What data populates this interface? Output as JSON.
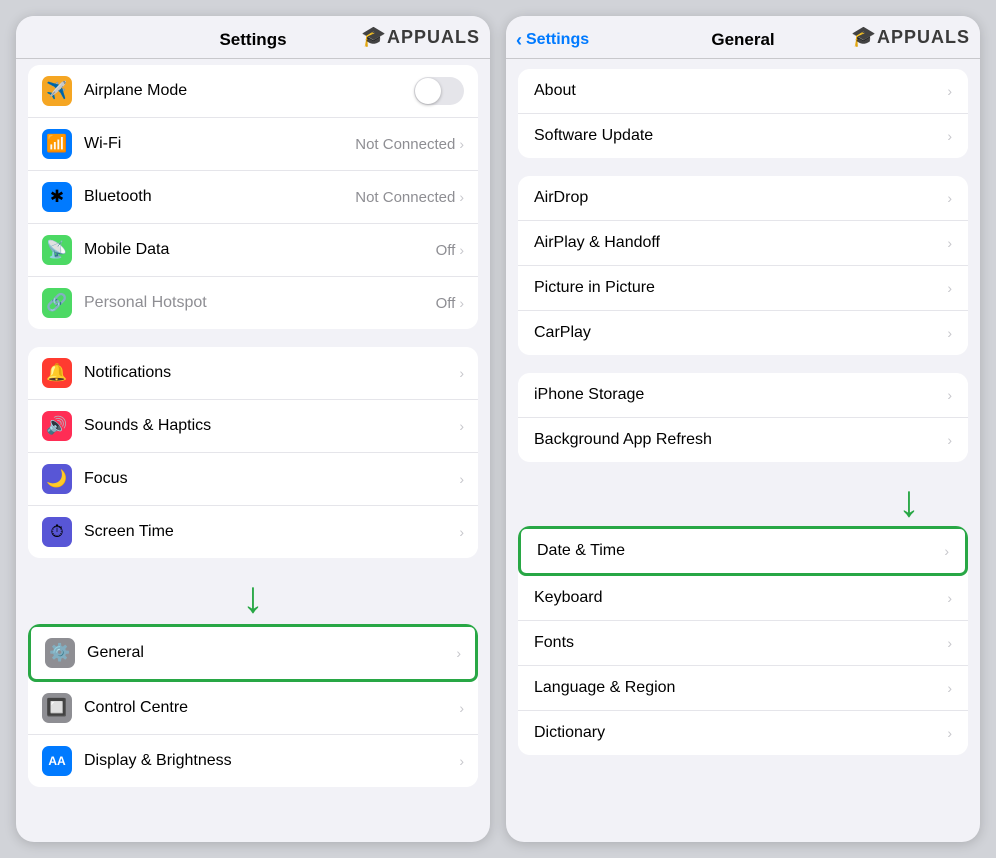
{
  "left_panel": {
    "header": "Settings",
    "appuals": "APPUALS",
    "groups": [
      {
        "id": "connectivity",
        "rows": [
          {
            "icon": "✈",
            "icon_bg": "#f5a623",
            "label": "Airplane Mode",
            "value": "",
            "type": "toggle"
          },
          {
            "icon": "📶",
            "icon_bg": "#007aff",
            "label": "Wi-Fi",
            "value": "Not Connected",
            "type": "chevron"
          },
          {
            "icon": "✱",
            "icon_bg": "#007aff",
            "label": "Bluetooth",
            "value": "Not Connected",
            "type": "chevron"
          },
          {
            "icon": "📡",
            "icon_bg": "#4cd964",
            "label": "Mobile Data",
            "value": "Off",
            "type": "chevron"
          },
          {
            "icon": "🔗",
            "icon_bg": "#4cd964",
            "label": "Personal Hotspot",
            "value": "Off",
            "type": "chevron"
          }
        ]
      },
      {
        "id": "notifications",
        "rows": [
          {
            "icon": "🔔",
            "icon_bg": "#ff3b30",
            "label": "Notifications",
            "value": "",
            "type": "chevron"
          },
          {
            "icon": "🔊",
            "icon_bg": "#ff2d55",
            "label": "Sounds & Haptics",
            "value": "",
            "type": "chevron"
          },
          {
            "icon": "🌙",
            "icon_bg": "#5856d6",
            "label": "Focus",
            "value": "",
            "type": "chevron"
          },
          {
            "icon": "⏱",
            "icon_bg": "#5856d6",
            "label": "Screen Time",
            "value": "",
            "type": "chevron"
          }
        ]
      },
      {
        "id": "system",
        "rows": [
          {
            "icon": "⚙",
            "icon_bg": "#8e8e93",
            "label": "General",
            "value": "",
            "type": "chevron",
            "highlighted": true
          },
          {
            "icon": "🔲",
            "icon_bg": "#8e8e93",
            "label": "Control Centre",
            "value": "",
            "type": "chevron"
          },
          {
            "icon": "AA",
            "icon_bg": "#007aff",
            "label": "Display & Brightness",
            "value": "",
            "type": "chevron"
          }
        ]
      }
    ]
  },
  "right_panel": {
    "back_label": "Settings",
    "header": "General",
    "appuals": "APPUALS",
    "groups": [
      {
        "id": "about",
        "rows": [
          {
            "label": "About",
            "type": "chevron"
          },
          {
            "label": "Software Update",
            "type": "chevron"
          }
        ]
      },
      {
        "id": "sharing",
        "rows": [
          {
            "label": "AirDrop",
            "type": "chevron"
          },
          {
            "label": "AirPlay & Handoff",
            "type": "chevron"
          },
          {
            "label": "Picture in Picture",
            "type": "chevron"
          },
          {
            "label": "CarPlay",
            "type": "chevron"
          }
        ]
      },
      {
        "id": "storage",
        "rows": [
          {
            "label": "iPhone Storage",
            "type": "chevron"
          },
          {
            "label": "Background App Refresh",
            "type": "chevron"
          }
        ]
      },
      {
        "id": "time",
        "rows": [
          {
            "label": "Date & Time",
            "type": "chevron",
            "highlighted": true
          },
          {
            "label": "Keyboard",
            "type": "chevron"
          },
          {
            "label": "Fonts",
            "type": "chevron"
          },
          {
            "label": "Language & Region",
            "type": "chevron"
          },
          {
            "label": "Dictionary",
            "type": "chevron"
          }
        ]
      }
    ]
  }
}
